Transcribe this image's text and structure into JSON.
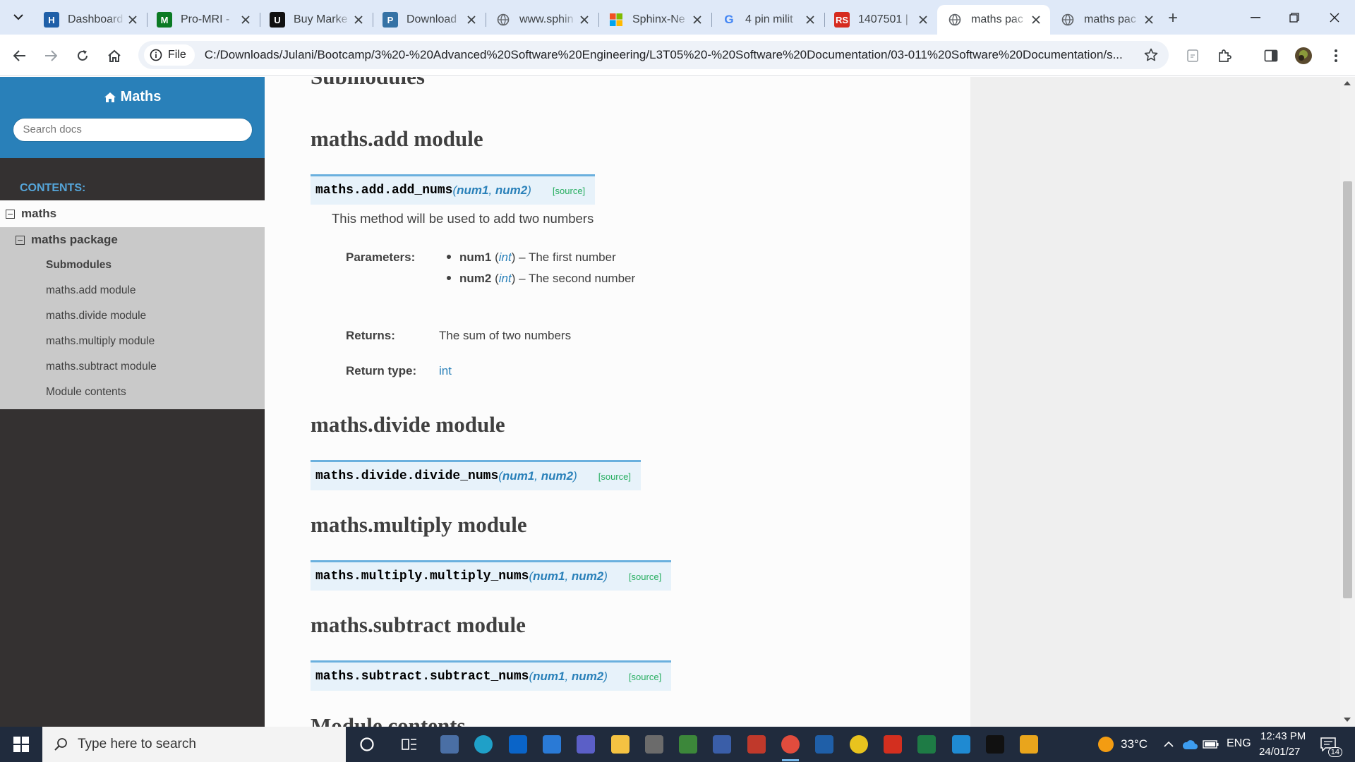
{
  "browser": {
    "tabs": [
      {
        "title": "Dashboard",
        "icon": "h-logo",
        "color": "#1f5fa8",
        "glyph": "H",
        "active": false
      },
      {
        "title": "Pro-MRI -",
        "icon": "mri-logo",
        "color": "#0b7a24",
        "glyph": "M",
        "active": false
      },
      {
        "title": "Buy Marke",
        "icon": "u-logo",
        "color": "#111111",
        "glyph": "U",
        "active": false
      },
      {
        "title": "Download",
        "icon": "python-logo",
        "color": "#3572a5",
        "glyph": "P",
        "active": false
      },
      {
        "title": "www.sphin",
        "icon": "globe-icon",
        "color": "#5f6368",
        "glyph": "",
        "active": false
      },
      {
        "title": "Sphinx-Ne",
        "icon": "windows-logo",
        "color": "#f25022",
        "glyph": "",
        "active": false
      },
      {
        "title": "4 pin milit",
        "icon": "google-logo",
        "color": "#4285f4",
        "glyph": "G",
        "active": false
      },
      {
        "title": "1407501 |",
        "icon": "rs-logo",
        "color": "#d62b1f",
        "glyph": "RS",
        "active": false
      },
      {
        "title": "maths pac",
        "icon": "globe-icon",
        "color": "#5f6368",
        "glyph": "",
        "active": true
      },
      {
        "title": "maths pac",
        "icon": "globe-icon",
        "color": "#5f6368",
        "glyph": "",
        "active": false
      }
    ],
    "site_chip": "File",
    "url": "C:/Downloads/Julani/Bootcamp/3%20-%20Advanced%20Software%20Engineering/L3T05%20-%20Software%20Documentation/03-011%20Software%20Documentation/s..."
  },
  "sidebar": {
    "title": "Maths",
    "search_placeholder": "Search docs",
    "caption": "CONTENTS:",
    "l1": "maths",
    "l2": "maths package",
    "items": [
      {
        "label": "Submodules",
        "current": true
      },
      {
        "label": "maths.add module",
        "current": false
      },
      {
        "label": "maths.divide module",
        "current": false
      },
      {
        "label": "maths.multiply module",
        "current": false
      },
      {
        "label": "maths.subtract module",
        "current": false
      },
      {
        "label": "Module contents",
        "current": false
      }
    ]
  },
  "content": {
    "submodules_heading": "Submodules",
    "add_heading": "maths.add module",
    "add_sig_name": "maths.add.add_nums",
    "add_sig_args_open": "(",
    "arg1": "num1",
    "arg_sep": ", ",
    "arg2": "num2",
    "add_sig_args_close": ")",
    "source_label": "[source]",
    "add_desc": "This method will be used to add two numbers",
    "params_label": "Parameters:",
    "params": [
      {
        "name": "num1",
        "type": "int",
        "desc": " – The first number"
      },
      {
        "name": "num2",
        "type": "int",
        "desc": " – The second number"
      }
    ],
    "returns_label": "Returns:",
    "returns_text": "The sum of two numbers",
    "rtype_label": "Return type:",
    "rtype_text": "int",
    "divide_heading": "maths.divide module",
    "divide_sig_name": "maths.divide.divide_nums",
    "multiply_heading": "maths.multiply module",
    "multiply_sig_name": "maths.multiply.multiply_nums",
    "subtract_heading": "maths.subtract module",
    "subtract_sig_name": "maths.subtract.subtract_nums",
    "contents_heading": "Module contents"
  },
  "taskbar": {
    "search_placeholder": "Type here to search",
    "temperature": "33°C",
    "language": "ENG",
    "time": "12:43 PM",
    "date": "24/01/27",
    "notification_count": "14"
  }
}
